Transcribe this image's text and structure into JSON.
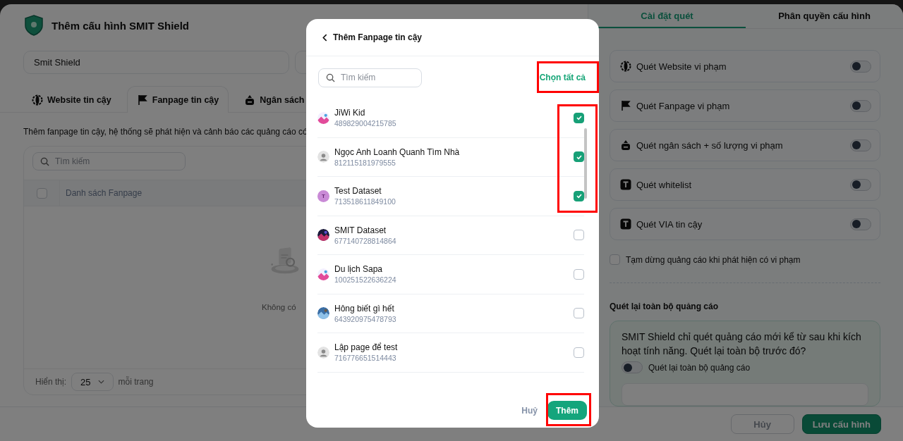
{
  "config_header": {
    "title": "Thêm cấu hình SMIT Shield"
  },
  "name_field": {
    "value": "Smit Shield"
  },
  "section_tabs": [
    {
      "label": "Website tin cậy",
      "selected": false
    },
    {
      "label": "Fanpage tin cậy",
      "selected": true
    },
    {
      "label": "Ngân sách",
      "selected": false
    }
  ],
  "description": "Thêm fanpage tin cậy, hệ thống sẽ phát hiện và cảnh báo các quảng cáo có",
  "fanpage_table": {
    "search_placeholder": "Tìm kiếm",
    "select_all_checked": false,
    "column_header": "Danh sách Fanpage",
    "empty_text": "Không có",
    "page_size_label": "Hiển thị:",
    "page_size": "25",
    "per_page_label": "mỗi trang"
  },
  "footer_buttons": [
    {
      "label": "Hủy",
      "kind": "secondary"
    },
    {
      "label": "Lưu cấu hình",
      "kind": "primary"
    }
  ],
  "settings_tabs": [
    {
      "label": "Cài đặt quét",
      "selected": true
    },
    {
      "label": "Phân quyền cấu hình",
      "selected": false
    }
  ],
  "scan_options": [
    {
      "label": "Quét Website vi phạm",
      "on": false
    },
    {
      "label": "Quét Fanpage vi phạm",
      "on": false
    },
    {
      "label": "Quét ngân sách + số lượng vi phạm",
      "on": false
    },
    {
      "label": "Quét whitelist",
      "on": false
    },
    {
      "label": "Quét VIA tin cậy",
      "on": false
    }
  ],
  "pause_ads": {
    "label": "Tạm dừng quảng cáo khi phát hiện có vi phạm",
    "checked": false
  },
  "rescan": {
    "heading": "Quét lại toàn bộ quảng cáo",
    "message": "SMIT Shield chỉ quét quảng cáo mới kể từ sau khi kích hoạt tính năng. Quét lại toàn bộ trước đó?",
    "toggle_label": "Quét lại toàn bộ quảng cáo",
    "on": false
  },
  "modal": {
    "title": "Thêm Fanpage tin cậy",
    "search_placeholder": "Tìm kiếm",
    "select_all": "Chọn tất cả",
    "cancel": "Huỷ",
    "confirm": "Thêm",
    "pages": [
      {
        "name": "JiWi Kid",
        "id": "489829004215785",
        "checked": true
      },
      {
        "name": "Ngọc Anh Loanh Quanh Tìm Nhà",
        "id": "812115181979555",
        "checked": true
      },
      {
        "name": "Test Dataset",
        "id": "713518611849100",
        "letter": "T",
        "checked": true
      },
      {
        "name": "SMIT Dataset",
        "id": "677140728814864",
        "checked": false
      },
      {
        "name": "Du lịch Sapa",
        "id": "100251522636224",
        "checked": false
      },
      {
        "name": "Hông biết gì hết",
        "id": "643920975478793",
        "checked": false
      },
      {
        "name": "Lập page để test",
        "id": "716776651514443",
        "checked": false
      }
    ]
  }
}
